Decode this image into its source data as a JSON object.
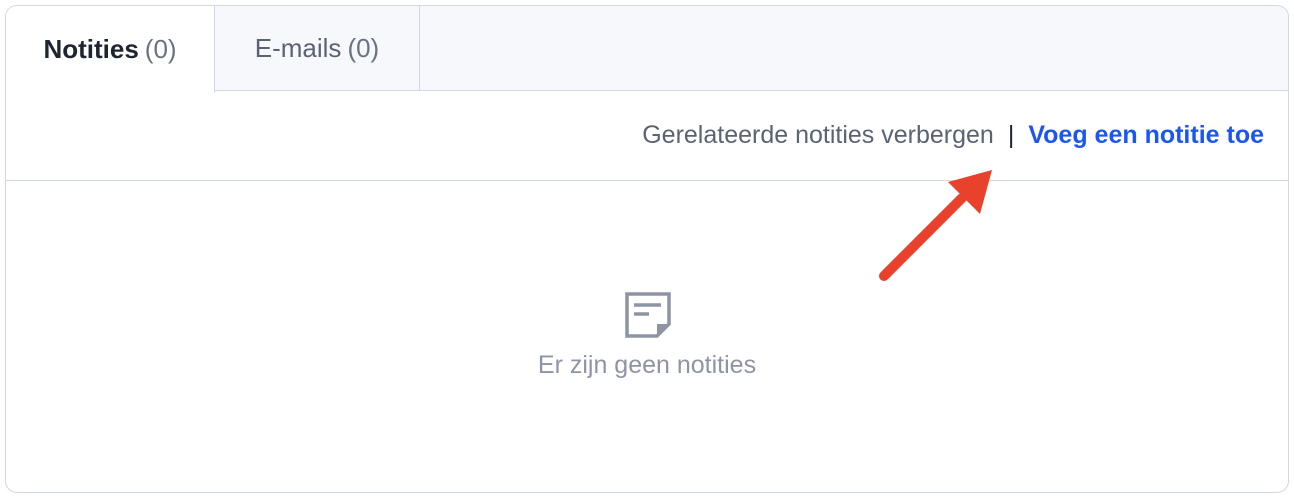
{
  "tabs": [
    {
      "name": "Notities",
      "count": "(0)",
      "active": true
    },
    {
      "name": "E-mails",
      "count": "(0)",
      "active": false
    }
  ],
  "toolbar": {
    "hide_related_label": "Gerelateerde notities verbergen",
    "separator": "|",
    "add_note_label": "Voeg een notitie toe"
  },
  "empty_state": {
    "icon": "note-icon",
    "message": "Er zijn geen notities"
  },
  "annotation": {
    "icon": "arrow-annotation",
    "color": "#e8412c"
  },
  "colors": {
    "link": "#1a56f0",
    "border": "#d3d7e3",
    "tabbar_bg": "#f7f8fc"
  }
}
